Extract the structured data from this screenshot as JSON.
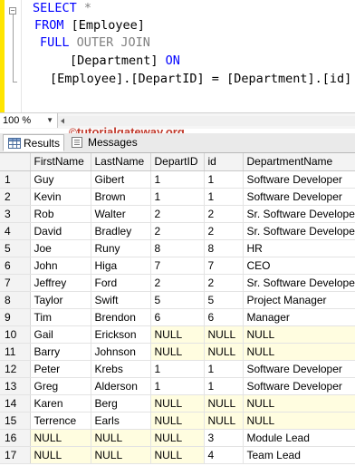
{
  "query": {
    "line1": {
      "kw": "SELECT",
      "rest": " *"
    },
    "line2": {
      "kw": "FROM",
      "rest": " [Employee]"
    },
    "line3": {
      "kw1": "FULL",
      "kw2": " OUTER JOIN"
    },
    "line4": {
      "text": "[Department]",
      "kw": " ON"
    },
    "line5": {
      "text": "[Employee].[DepartID] = [Department].[id]"
    }
  },
  "zoom": {
    "value": "100 %"
  },
  "watermark": {
    "symbol": "©",
    "text": "tutorialgateway.org"
  },
  "tabs": {
    "results": "Results",
    "messages": "Messages"
  },
  "grid": {
    "columns": [
      "FirstName",
      "LastName",
      "DepartID",
      "id",
      "DepartmentName"
    ],
    "rows": [
      [
        "1",
        "Guy",
        "Gibert",
        "1",
        "1",
        "Software Developer"
      ],
      [
        "2",
        "Kevin",
        "Brown",
        "1",
        "1",
        "Software Developer"
      ],
      [
        "3",
        "Rob",
        "Walter",
        "2",
        "2",
        "Sr. Software Developer"
      ],
      [
        "4",
        "David",
        "Bradley",
        "2",
        "2",
        "Sr. Software Developer"
      ],
      [
        "5",
        "Joe",
        "Runy",
        "8",
        "8",
        "HR"
      ],
      [
        "6",
        "John",
        "Higa",
        "7",
        "7",
        "CEO"
      ],
      [
        "7",
        "Jeffrey",
        "Ford",
        "2",
        "2",
        "Sr. Software Developer"
      ],
      [
        "8",
        "Taylor",
        "Swift",
        "5",
        "5",
        "Project Manager"
      ],
      [
        "9",
        "Tim",
        "Brendon",
        "6",
        "6",
        "Manager"
      ],
      [
        "10",
        "Gail",
        "Erickson",
        "NULL",
        "NULL",
        "NULL"
      ],
      [
        "11",
        "Barry",
        "Johnson",
        "NULL",
        "NULL",
        "NULL"
      ],
      [
        "12",
        "Peter",
        "Krebs",
        "1",
        "1",
        "Software Developer"
      ],
      [
        "13",
        "Greg",
        "Alderson",
        "1",
        "1",
        "Software Developer"
      ],
      [
        "14",
        "Karen",
        "Berg",
        "NULL",
        "NULL",
        "NULL"
      ],
      [
        "15",
        "Terrence",
        "Earls",
        "NULL",
        "NULL",
        "NULL"
      ],
      [
        "16",
        "NULL",
        "NULL",
        "NULL",
        "3",
        "Module Lead"
      ],
      [
        "17",
        "NULL",
        "NULL",
        "NULL",
        "4",
        "Team Lead"
      ]
    ]
  },
  "colors": {
    "keyword": "#0000ff",
    "operator": "#808080",
    "null_cell": "#fffde0",
    "watermark": "#c0392b",
    "gutter_marker": "#ffe500"
  }
}
